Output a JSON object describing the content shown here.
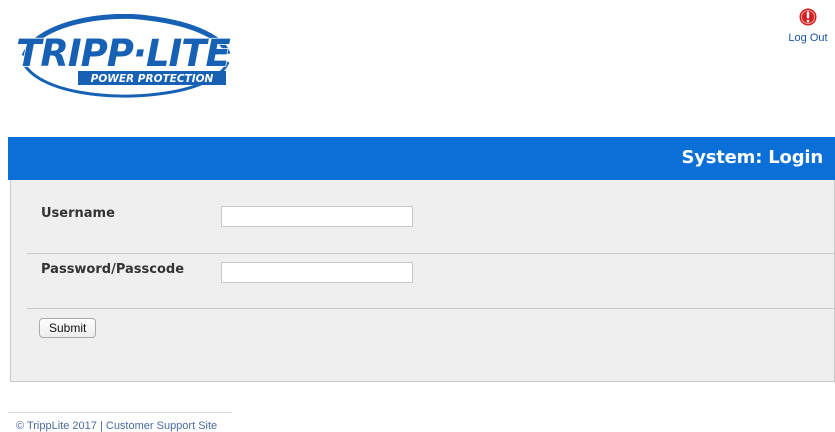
{
  "header": {
    "logo": {
      "name": "TRIPP·LITE",
      "tagline": "POWER PROTECTION",
      "colors": {
        "blue": "#1761b5",
        "white": "#ffffff"
      }
    },
    "logout": {
      "label": "Log Out",
      "icon": "logout-power-icon",
      "icon_color": "#d62020"
    }
  },
  "titlebar": {
    "title": "System: Login",
    "color": "#0a6fd6"
  },
  "form": {
    "username_label": "Username",
    "username_value": "",
    "password_label": "Password/Passcode",
    "password_value": "",
    "submit_label": "Submit"
  },
  "footer": {
    "copyright": "© TrippLite 2017",
    "separator": "|",
    "support_link": "Customer Support Site"
  }
}
